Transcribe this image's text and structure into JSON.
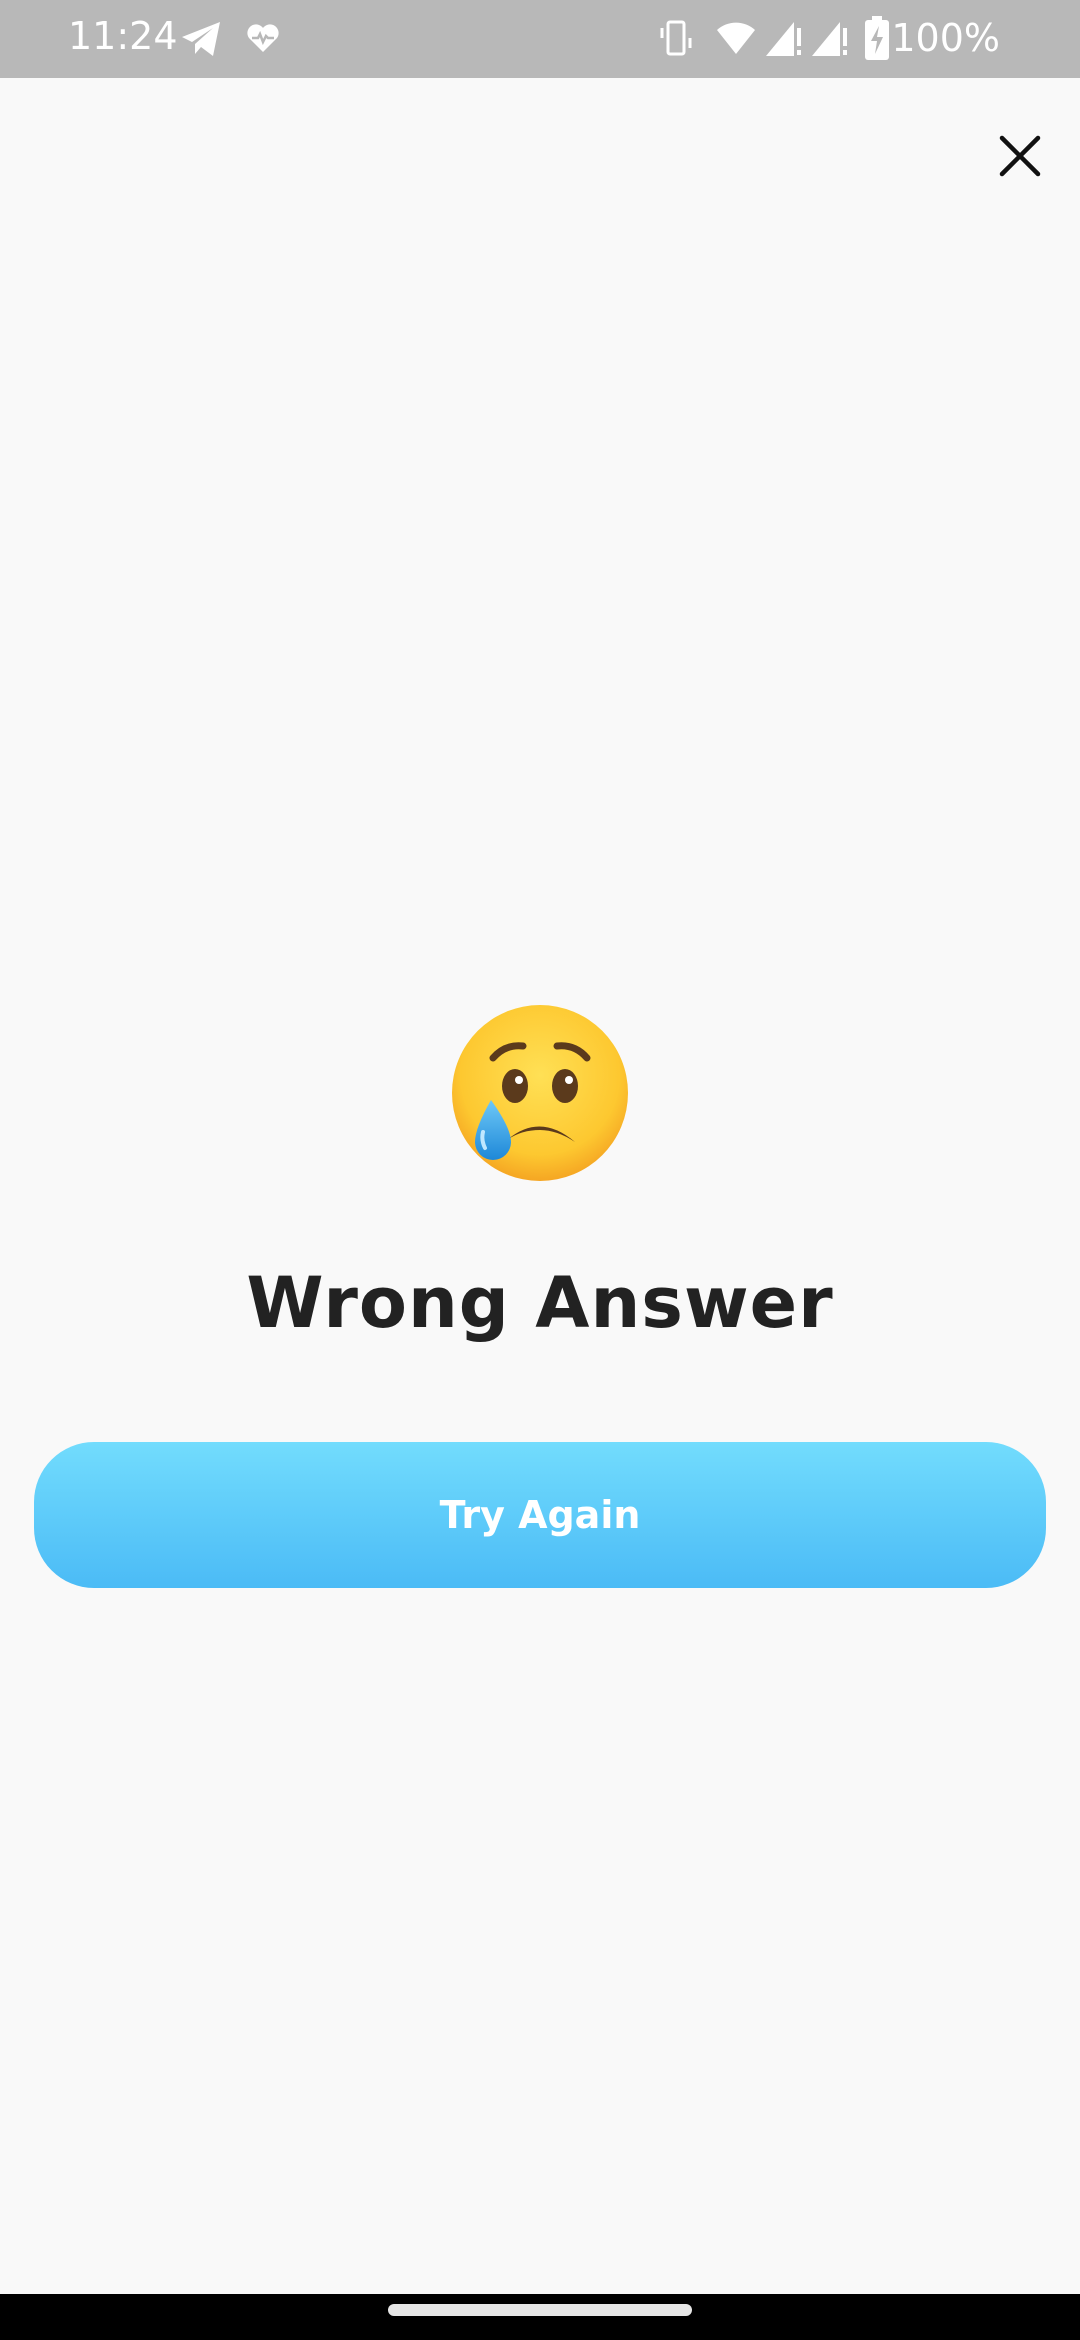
{
  "status_bar": {
    "time": "11:24",
    "battery": "100%",
    "icons": [
      "telegram-icon",
      "health-icon",
      "vibrate-icon",
      "wifi-icon",
      "signal-icon",
      "signal-icon",
      "battery-charging-icon"
    ]
  },
  "dialog": {
    "close_icon": "close-icon",
    "emoji": "crying-face-emoji",
    "title": "Wrong Answer",
    "button_label": "Try Again"
  },
  "colors": {
    "background": "#f9f9f9",
    "status_bar": "#b8b8b8",
    "button_top": "#72dcfd",
    "button_bottom": "#4bbbf6",
    "title_text": "#222222"
  }
}
